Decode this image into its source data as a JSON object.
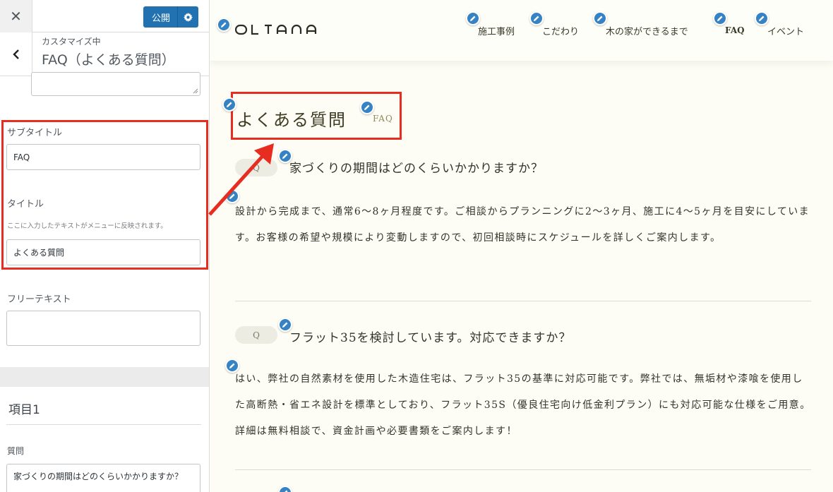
{
  "customizer": {
    "close_label": "✕",
    "publish_label": "公開",
    "breadcrumb": "カスタマイズ中",
    "section_title": "FAQ（よくある質問）",
    "subtitle_label": "サブタイトル",
    "subtitle_value": "FAQ",
    "title_label": "タイトル",
    "title_desc": "ここに入力したテキストがメニューに反映されます。",
    "title_value": "よくある質問",
    "freetext_label": "フリーテキスト",
    "freetext_value": "",
    "item_heading": "項目1",
    "question_label": "質問",
    "question_value": "家づくりの期間はどのくらいかかりますか？"
  },
  "site": {
    "logo": "OLTANA",
    "nav": [
      "施工事例",
      "こだわり",
      "木の家ができるまで",
      "FAQ",
      "イベント"
    ],
    "faq_title": "よくある質問",
    "faq_subtitle": "FAQ",
    "q_badge": "Q",
    "items": [
      {
        "question": "家づくりの期間はどのくらいかかりますか？",
        "answer": "設計から完成まで、通常6〜8ヶ月程度です。ご相談からプランニングに2〜3ヶ月、施工に4〜5ヶ月を目安にしています。お客様の希望や規模により変動しますので、初回相談時にスケジュールを詳しくご案内します。"
      },
      {
        "question": "フラット35を検討しています。対応できますか？",
        "answer": "はい、弊社の自然素材を使用した木造住宅は、フラット35の基準に対応可能です。弊社では、無垢材や漆喰を使用した高断熱・省エネ設計を標準としており、フラット35S（優良住宅向け低金利プラン）にも対応可能な仕様をご用意。詳細は無料相談で、資金計画や必要書類をご案内します！"
      }
    ]
  },
  "colors": {
    "publish_blue": "#2271b1",
    "edit_pin_blue": "#3582c4",
    "annotation_red": "#e62d1f",
    "page_bg": "#fdfdf6"
  },
  "icons": {
    "close": "close-icon",
    "publish_settings": "gear-icon",
    "back": "chevron-left-icon",
    "edit": "pencil-icon"
  }
}
